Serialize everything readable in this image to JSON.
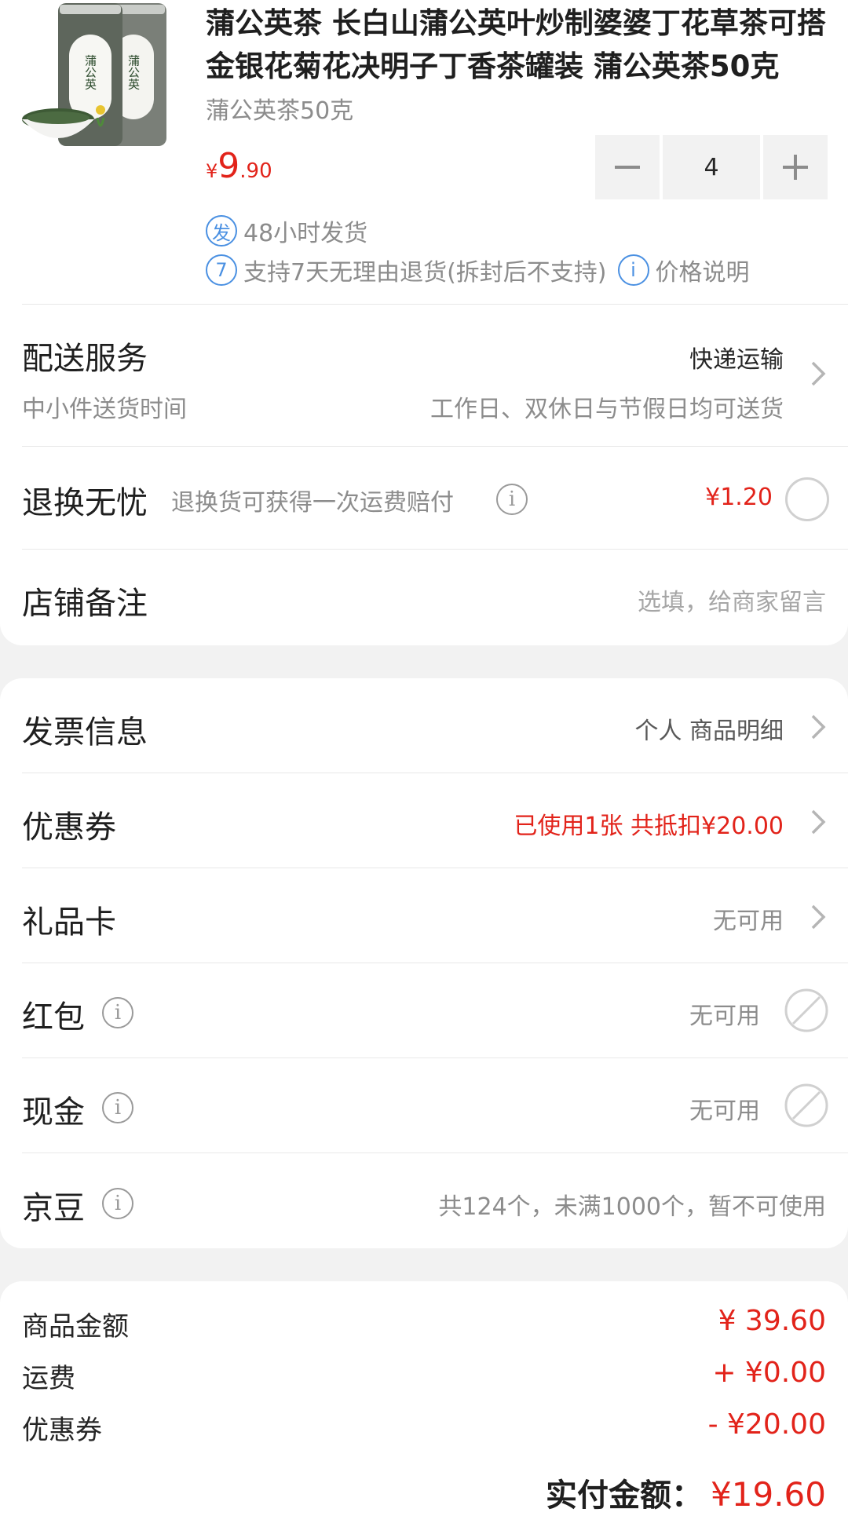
{
  "product": {
    "title": "蒲公英茶 长白山蒲公英叶炒制婆婆丁花草茶可搭金银花菊花决明子丁香茶罐装 蒲公英茶50克",
    "sku": "蒲公英茶50克",
    "price_currency": "¥",
    "price_int": "9",
    "price_dec": ".90",
    "quantity": "4",
    "image_label": "蒲公英",
    "services": {
      "ship_icon": "发",
      "ship_text": "48小时发货",
      "return_icon": "7",
      "return_text": "支持7天无理由退货(拆封后不支持)",
      "price_icon": "i",
      "price_text": "价格说明"
    }
  },
  "delivery": {
    "title": "配送服务",
    "method": "快递运输",
    "subtitle": "中小件送货时间",
    "time": "工作日、双休日与节假日均可送货"
  },
  "return_insurance": {
    "title": "退换无忧",
    "desc": "退换货可获得一次运费赔付",
    "price": "¥1.20"
  },
  "note": {
    "title": "店铺备注",
    "placeholder": "选填，给商家留言"
  },
  "invoice": {
    "title": "发票信息",
    "value": "个人 商品明细"
  },
  "coupon": {
    "title": "优惠券",
    "value": "已使用1张 共抵扣¥20.00"
  },
  "giftcard": {
    "title": "礼品卡",
    "value": "无可用"
  },
  "redpacket": {
    "title": "红包",
    "value": "无可用"
  },
  "cash": {
    "title": "现金",
    "value": "无可用"
  },
  "jingdou": {
    "title": "京豆",
    "value": "共124个，未满1000个，暂不可使用"
  },
  "summary": {
    "goods_label": "商品金额",
    "goods_value": "¥ 39.60",
    "shipping_label": "运费",
    "shipping_value": "+ ¥0.00",
    "coupon_label": "优惠券",
    "coupon_value": "- ¥20.00",
    "total_label": "实付金额：",
    "total_value": "¥19.60"
  },
  "icons": [
    "dandelion-tea-product-image",
    "minus-icon",
    "plus-icon",
    "ship-badge-icon",
    "return-7day-icon",
    "info-icon",
    "chevron-right-icon",
    "radio-circle-icon",
    "disabled-circle-icon"
  ],
  "colors": {
    "accent": "#e2231a",
    "service_blue": "#4a90e2",
    "background": "#f2f2f2"
  }
}
